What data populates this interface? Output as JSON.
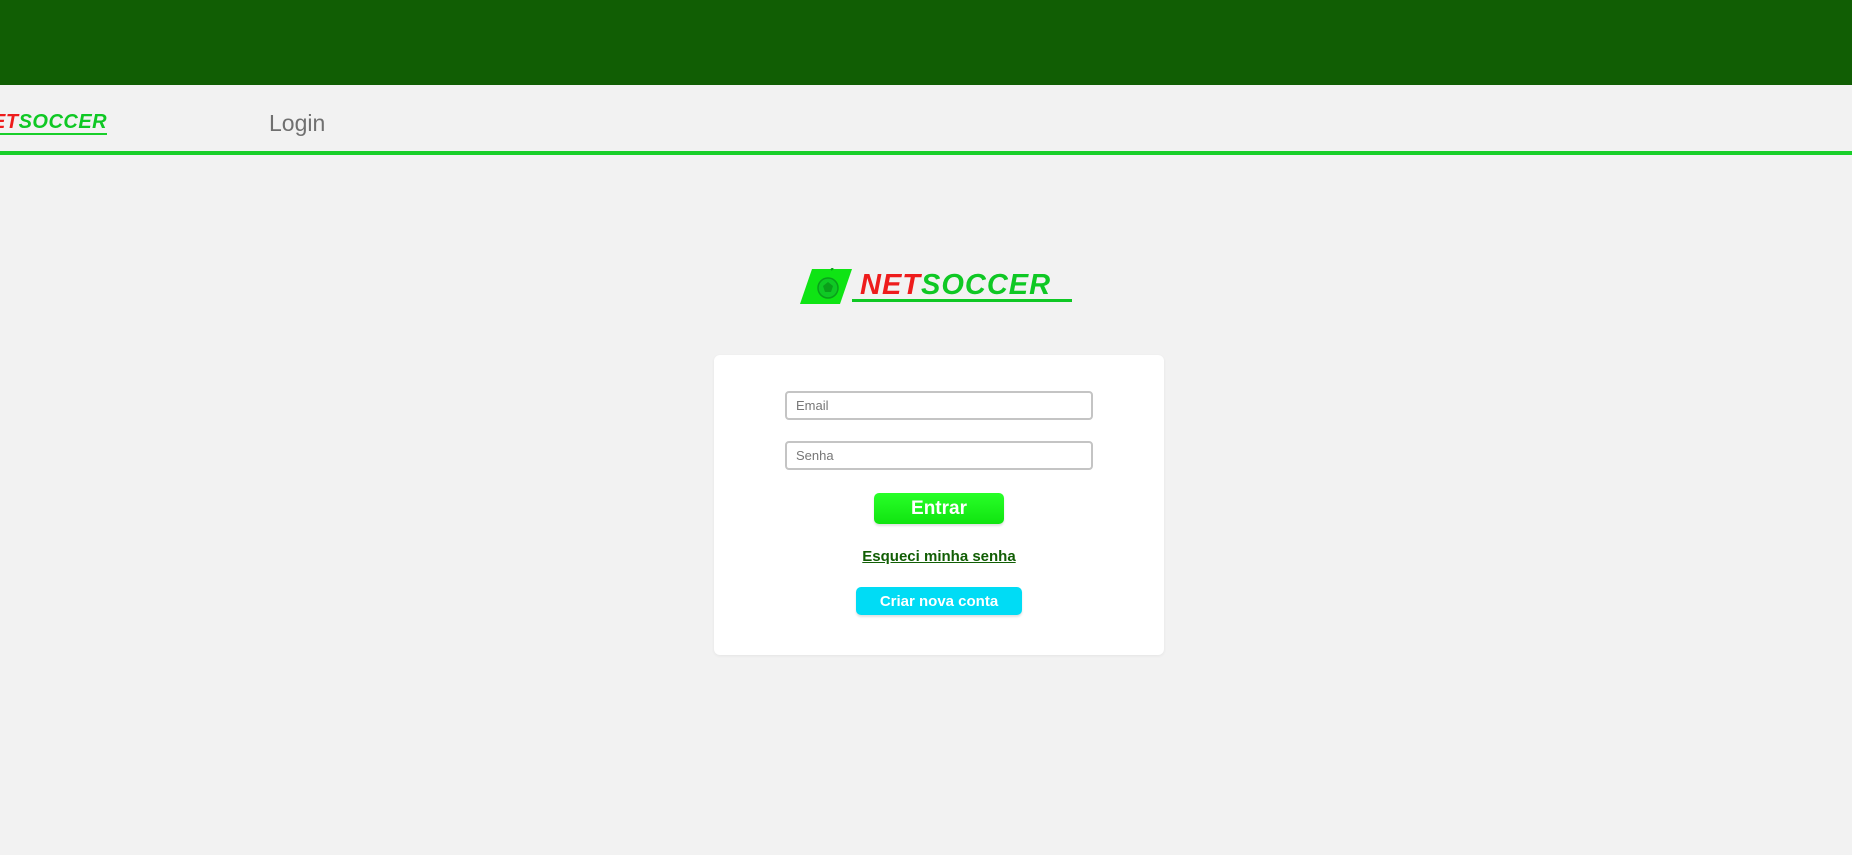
{
  "header": {
    "logo_text_red": "NET",
    "logo_text_green": "SOCCER",
    "visible_logo_text_red": "ET",
    "page_title": "Login"
  },
  "brand": {
    "logo_text_red": "NET",
    "logo_text_green": "SOCCER",
    "badge_icon": "soccer-ball-icon"
  },
  "login_form": {
    "email_placeholder": "Email",
    "password_placeholder": "Senha",
    "submit_label": "Entrar",
    "forgot_password_label": "Esqueci minha senha",
    "create_account_label": "Criar nova conta"
  },
  "colors": {
    "top_bar": "#115e04",
    "nav_accent": "#19cf2a",
    "brand_red": "#ee1c1c",
    "brand_green": "#0fc824",
    "submit_button": "#1ef21e",
    "create_account_button": "#00dcf5",
    "link": "#115e04"
  }
}
